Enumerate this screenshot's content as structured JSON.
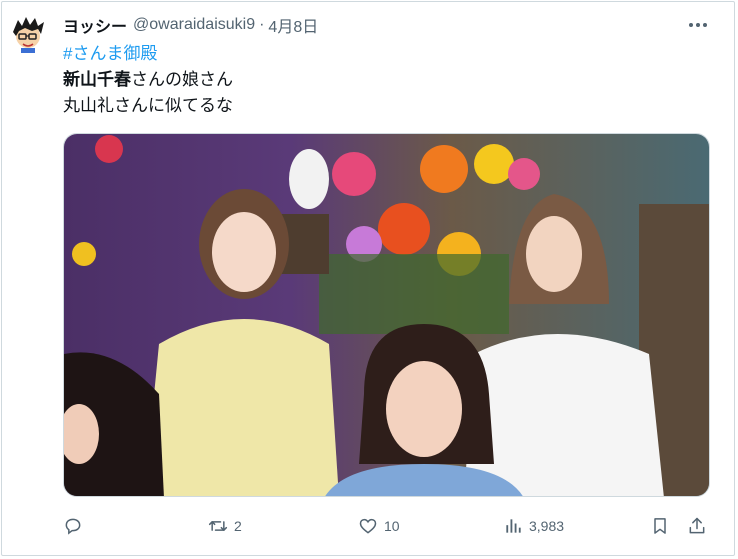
{
  "post": {
    "author": {
      "display_name": "ヨッシー",
      "handle": "@owaraidaisuki9",
      "separator": "·",
      "date": "4月8日"
    },
    "text": {
      "hashtag": "#さんま御殿",
      "line2_bold": "新山千春",
      "line2_rest": "さんの娘さん",
      "line3": "丸山礼さんに似てるな"
    },
    "media": {
      "icon": "photo"
    },
    "actions": {
      "reply": {
        "icon": "reply-icon",
        "count": ""
      },
      "repost": {
        "icon": "repost-icon",
        "count": "2"
      },
      "like": {
        "icon": "heart-icon",
        "count": "10"
      },
      "views": {
        "icon": "analytics-icon",
        "count": "3,983"
      },
      "bookmark": {
        "icon": "bookmark-icon"
      },
      "share": {
        "icon": "share-icon"
      }
    }
  },
  "colors": {
    "text": "#0f1419",
    "secondary": "#536471",
    "link": "#1d9bf0",
    "border": "#cfd9de"
  }
}
